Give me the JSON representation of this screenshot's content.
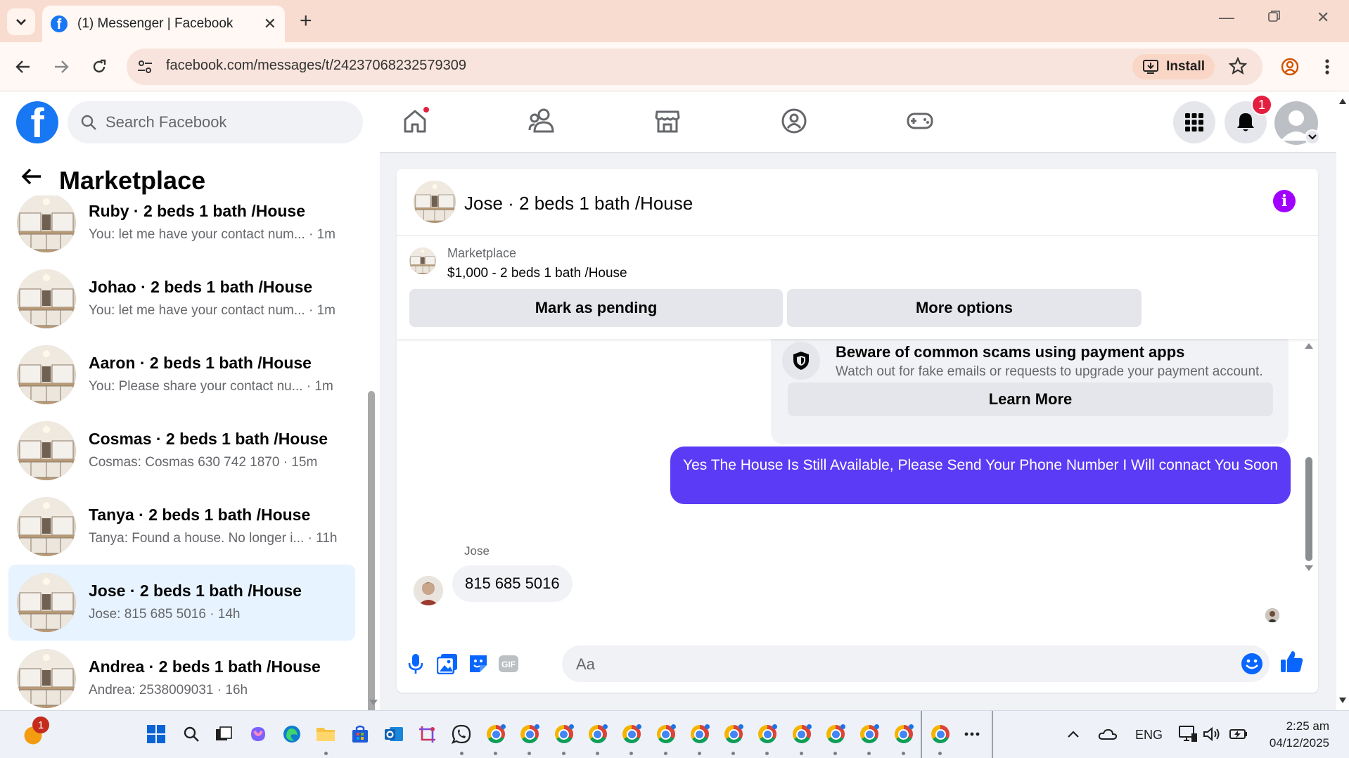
{
  "browser": {
    "tab_title": "(1) Messenger | Facebook",
    "url": "facebook.com/messages/t/24237068232579309",
    "install_label": "Install"
  },
  "fb_header": {
    "search_placeholder": "Search Facebook",
    "notification_count": "1",
    "nav_icons": [
      "home-icon",
      "friends-icon",
      "marketplace-icon",
      "groups-icon",
      "gaming-icon"
    ]
  },
  "left_panel": {
    "title": "Marketplace",
    "conversations": [
      {
        "name": "Ruby · 2 beds 1 bath /House",
        "preview": "You: let me have your contact num... · 1m",
        "active": false
      },
      {
        "name": "Johao · 2 beds 1 bath /House",
        "preview": "You: let me have your contact num... · 1m",
        "active": false
      },
      {
        "name": "Aaron · 2 beds 1 bath /House",
        "preview": "You: Please share your contact nu...  · 1m",
        "active": false
      },
      {
        "name": "Cosmas · 2 beds 1 bath /House",
        "preview": "Cosmas: Cosmas 630 742 1870 · 15m",
        "active": false
      },
      {
        "name": "Tanya · 2 beds 1 bath /House",
        "preview": "Tanya: Found a house. No longer i... · 11h",
        "active": false
      },
      {
        "name": "Jose · 2 beds 1 bath /House",
        "preview": "Jose: 815 685 5016 · 14h",
        "active": true
      },
      {
        "name": "Andrea · 2 beds 1 bath /House",
        "preview": "Andrea: 2538009031 · 16h",
        "active": false
      }
    ]
  },
  "chat": {
    "title": "Jose · 2 beds 1 bath /House",
    "listing_label": "Marketplace",
    "listing_price": "$1,000 - 2 beds 1 bath /House",
    "mark_pending_label": "Mark as pending",
    "more_options_label": "More options",
    "warning_title": "Beware of common scams using payment apps",
    "warning_text": "Watch out for fake emails or requests to upgrade your payment account.",
    "learn_more_label": "Learn More",
    "outgoing_message": "Yes The House Is Still Available, Please Send Your Phone Number I Will connact You Soon",
    "incoming_sender": "Jose",
    "incoming_message": "815 685 5016",
    "composer_placeholder": "Aa"
  },
  "taskbar": {
    "start_badge": "1",
    "language": "ENG",
    "time": "2:25 am",
    "date": "04/12/2025"
  },
  "colors": {
    "fb_blue": "#1877f2",
    "outgoing_bubble": "#5b3bf5",
    "active_conversation": "#e7f3ff",
    "badge_red": "#e41e3f",
    "tab_strip": "#f9dcd0"
  }
}
